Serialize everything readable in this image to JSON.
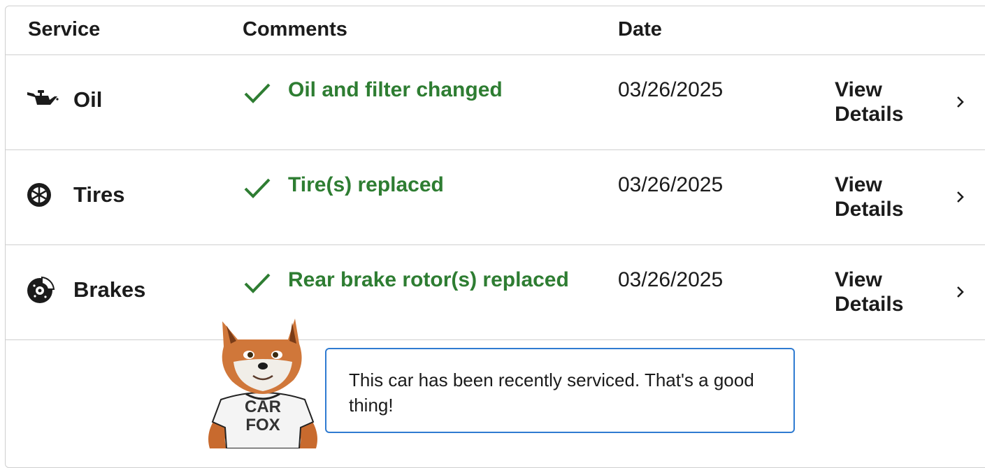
{
  "table": {
    "headers": {
      "service": "Service",
      "comments": "Comments",
      "date": "Date"
    },
    "rows": [
      {
        "service": "Oil",
        "icon": "oil-can-icon",
        "comment": "Oil and filter changed",
        "date": "03/26/2025",
        "view_line1": "View",
        "view_line2": "Details"
      },
      {
        "service": "Tires",
        "icon": "tire-icon",
        "comment": "Tire(s) replaced",
        "date": "03/26/2025",
        "view_line1": "View",
        "view_line2": "Details"
      },
      {
        "service": "Brakes",
        "icon": "brake-disc-icon",
        "comment": "Rear brake rotor(s) replaced",
        "date": "03/26/2025",
        "view_line1": "View",
        "view_line2": "Details"
      }
    ]
  },
  "mascot": {
    "shirt_line1": "CAR",
    "shirt_line2": "FOX"
  },
  "message": "This car has been recently serviced. That's a good thing!",
  "colors": {
    "comment_green": "#2e7d32",
    "bubble_border": "#2f7bd1",
    "divider": "#cfcfcf"
  }
}
